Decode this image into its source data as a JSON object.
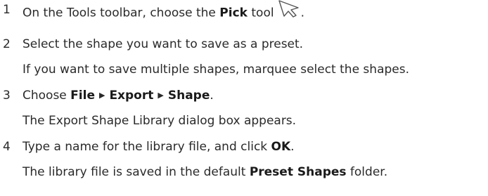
{
  "steps": [
    {
      "number": "1",
      "before": "On the Tools toolbar, choose the ",
      "bold": "Pick",
      "after": " tool",
      "icon": "pick-tool-icon",
      "end": "."
    },
    {
      "number": "2",
      "text": "Select the shape you want to save as a preset.",
      "note": "If you want to save multiple shapes, marquee select the shapes."
    },
    {
      "number": "3",
      "before": "Choose ",
      "menu_file": "File",
      "menu_export": "Export",
      "menu_shape": "Shape",
      "end": ".",
      "note": "The Export Shape Library dialog box appears."
    },
    {
      "number": "4",
      "before": "Type a name for the library file, and click ",
      "bold": "OK",
      "end": ".",
      "note_before": "The library file is saved in the default ",
      "note_bold": "Preset Shapes",
      "note_after": " folder."
    }
  ]
}
